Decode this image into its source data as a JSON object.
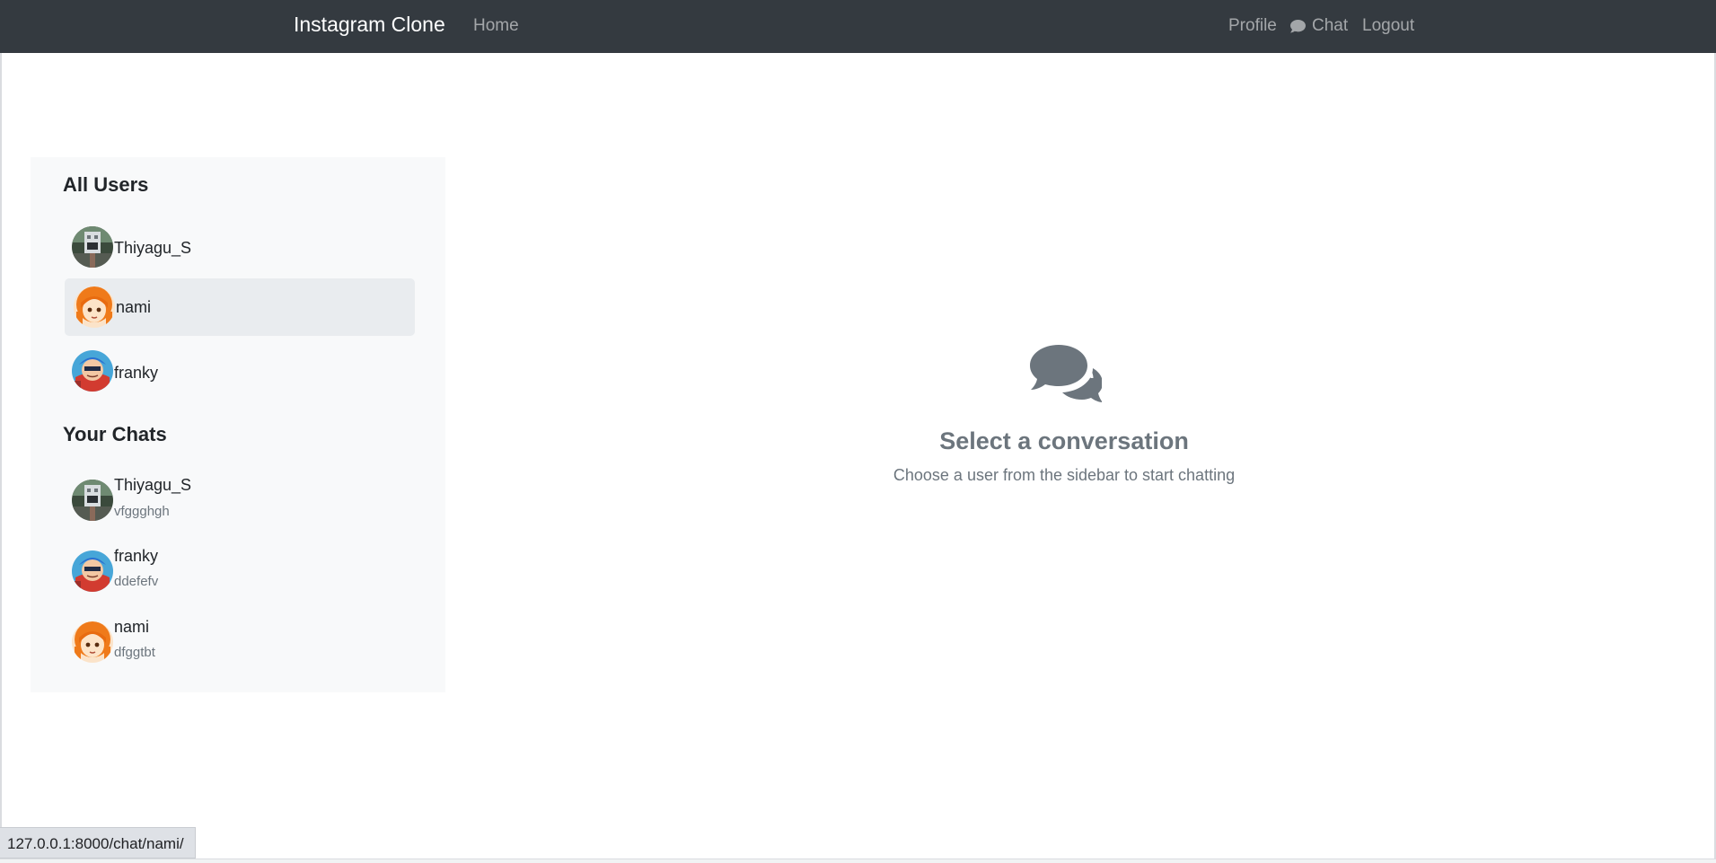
{
  "navbar": {
    "brand": "Instagram Clone",
    "home": "Home",
    "profile": "Profile",
    "chat": "Chat",
    "logout": "Logout"
  },
  "sidebar": {
    "all_users_title": "All Users",
    "users": [
      {
        "name": "Thiyagu_S",
        "avatar": "building-photo-avatar"
      },
      {
        "name": "nami",
        "avatar": "orange-hair-anime-avatar",
        "active": true
      },
      {
        "name": "franky",
        "avatar": "blue-hair-anime-avatar"
      }
    ],
    "your_chats_title": "Your Chats",
    "chats": [
      {
        "name": "Thiyagu_S",
        "preview": "vfggghgh",
        "avatar": "building-photo-avatar"
      },
      {
        "name": "franky",
        "preview": "ddefefv",
        "avatar": "blue-hair-anime-avatar"
      },
      {
        "name": "nami",
        "preview": "dfggtbt",
        "avatar": "orange-hair-anime-avatar"
      }
    ]
  },
  "main": {
    "icon": "comments-icon",
    "title": "Select a conversation",
    "subtitle": "Choose a user from the sidebar to start chatting"
  },
  "status_bar": {
    "url": "127.0.0.1:8000/chat/nami/"
  },
  "colors": {
    "navbar_bg": "#343a40",
    "sidebar_bg": "#f8f9fa",
    "active_item_bg": "#e9ecef",
    "muted_text": "#6c757d"
  }
}
